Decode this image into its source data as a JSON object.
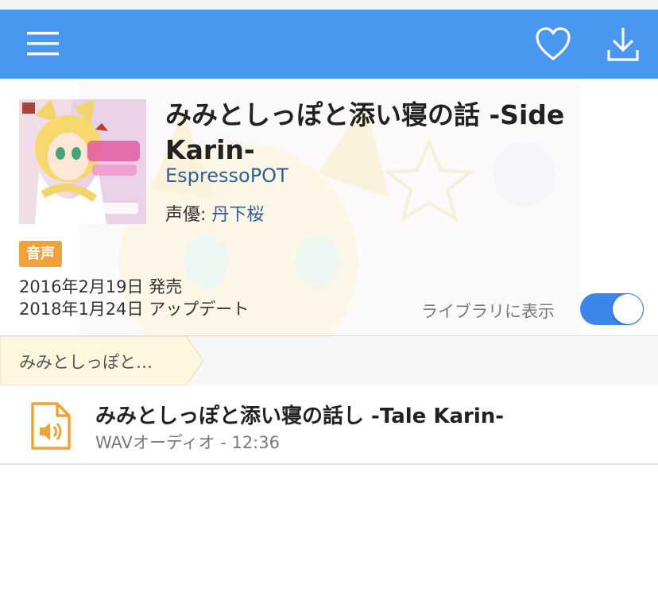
{
  "header": {
    "menu_icon": "hamburger-menu-icon",
    "favorite_icon": "heart-icon",
    "download_icon": "download-icon",
    "color": "#4a97f2"
  },
  "work": {
    "title": "みみとしっぽと添い寝の話 -Side Karin-",
    "circle": "EspressoPOT",
    "voice_actor_label": "声優: ",
    "voice_actor": "丹下桜",
    "category_badge": "音声",
    "release_date": "2016年2月19日 発売",
    "update_date": "2018年1月24日 アップデート",
    "library_label": "ライブラリに表示",
    "library_visible": true
  },
  "breadcrumb": {
    "label": "みみとしっぽと…"
  },
  "files": [
    {
      "name": "みみとしっぽと添い寝の話し -Tale Karin-",
      "meta": "WAVオーディオ - 12:36",
      "icon": "audio-file-icon"
    }
  ],
  "colors": {
    "accent": "#4a97f2",
    "badge": "#f0a13a",
    "link": "#2f5f9a",
    "toggle_on": "#3b86e8",
    "file_icon": "#f0a13a"
  }
}
